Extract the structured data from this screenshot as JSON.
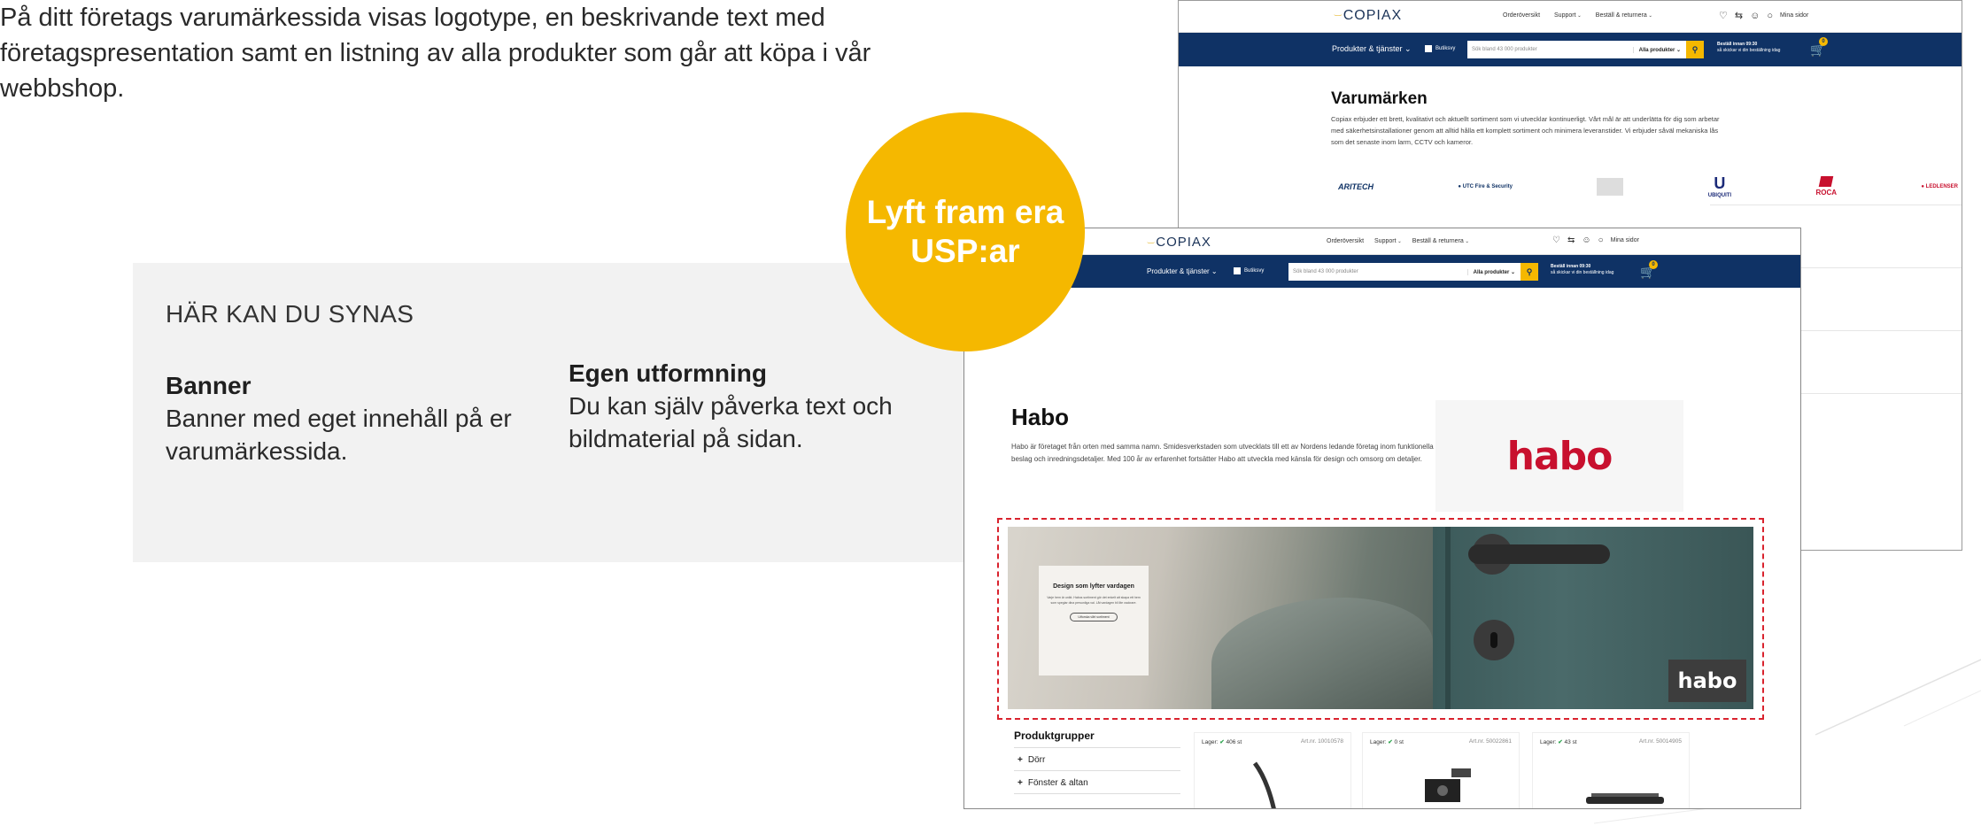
{
  "intro": "På ditt företags varumärkessida visas logotype, en beskrivande text med företagspresentation samt en listning av alla produkter som går att köpa i vår webbshop.",
  "panel": {
    "heading": "HÄR KAN DU SYNAS",
    "features": [
      {
        "title": "Banner",
        "text": "Banner med eget innehåll på er varumärkessida."
      },
      {
        "title": "Egen utformning",
        "text": "Du kan själv påverka text och bildmaterial på sidan."
      }
    ]
  },
  "badge": {
    "line1": "Lyft fram era",
    "line2": "USP:ar"
  },
  "site": {
    "logo": "COPIAX",
    "top_links": [
      "Orderöversikt",
      "Support",
      "Beställ & returnera"
    ],
    "account": "Mina sidor",
    "menu": "Produkter & tjänster",
    "store_toggle": "Butiksvy",
    "search_placeholder": "Sök bland 43 000 produkter",
    "search_category": "Alla produkter",
    "order_cutoff": "Beställ innan 09:30",
    "order_note": "så skickar vi din beställning idag",
    "cart_count": "0"
  },
  "brands_page": {
    "title": "Varumärken",
    "description": "Copiax erbjuder ett brett, kvalitativt och aktuellt sortiment som vi utvecklar kontinuerligt. Vårt mål är att underlätta för dig som arbetar med säkerhetsinstallationer genom att alltid hålla ett komplett sortiment och minimera leveranstider. Vi erbjuder såväl mekaniska lås som det senaste inom larm, CCTV och kameror.",
    "brands": [
      "ARITECH",
      "UTC Fire & Security",
      "",
      "UBIQUITI",
      "ROCA",
      "LEDLENSER"
    ]
  },
  "brand_page": {
    "title": "Habo",
    "description": "Habo är företaget från orten med samma namn. Smidesverkstaden som utvecklats till ett av Nordens ledande företag inom funktionella beslag och inredningsdetaljer. Med 100 år av erfarenhet fortsätter Habo att utveckla med känsla för design och omsorg om detaljer.",
    "logo_text": "habo",
    "banner": {
      "heading": "Design som lyfter vardagen",
      "text": "Varje hem är unikt. Habos sortiment gör det enkelt att skapa ett hem som speglar dina personliga val. Låt vardagen bli lite vackrare.",
      "button": "Utforska vårt sortiment",
      "logo_text": "habo"
    },
    "product_groups_title": "Produktgrupper",
    "product_groups": [
      "Dörr",
      "Fönster & altan"
    ],
    "products": [
      {
        "stock": "406 st",
        "art": "Art.nr. 10010578"
      },
      {
        "stock": "0 st",
        "art": "Art.nr. 50022861"
      },
      {
        "stock": "43 st",
        "art": "Art.nr. 50014905"
      }
    ],
    "stock_label": "Lager:"
  }
}
